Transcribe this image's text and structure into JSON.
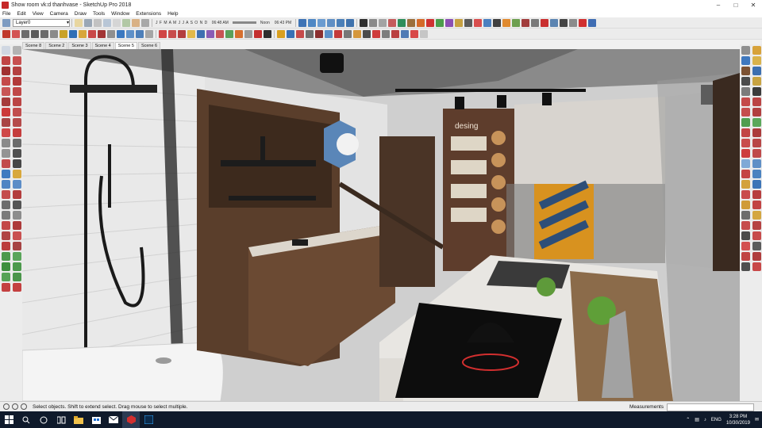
{
  "window": {
    "title": "Show room vk:d thanhvase - SketchUp Pro 2018",
    "buttons": [
      "minimize",
      "maximize",
      "close"
    ]
  },
  "menu": [
    "File",
    "Edit",
    "View",
    "Camera",
    "Draw",
    "Tools",
    "Window",
    "Extensions",
    "Help"
  ],
  "toolbar": {
    "layer_value": "Layer0",
    "months": "J F M A M J J A S O N D",
    "time_start": "06:48 AM",
    "time_noon": "Noon",
    "time_end": "06:43 PM"
  },
  "scenes": [
    "Scene 8",
    "Scene 2",
    "Scene 3",
    "Scene 4",
    "Scene 5",
    "Scene 6"
  ],
  "active_scene": "Scene 5",
  "viewport": {
    "wall_sign": "desing"
  },
  "status": {
    "hint": "Select objects. Shift to extend select. Drag mouse to select multiple.",
    "measurements_label": "Measurements",
    "measurements_value": ""
  },
  "taskbar": {
    "lang": "ENG",
    "time": "3:28 PM",
    "date": "10/30/2019"
  },
  "colors": {
    "taskbar_bg": "#0f1a2b",
    "accent": "#d32f2f"
  }
}
